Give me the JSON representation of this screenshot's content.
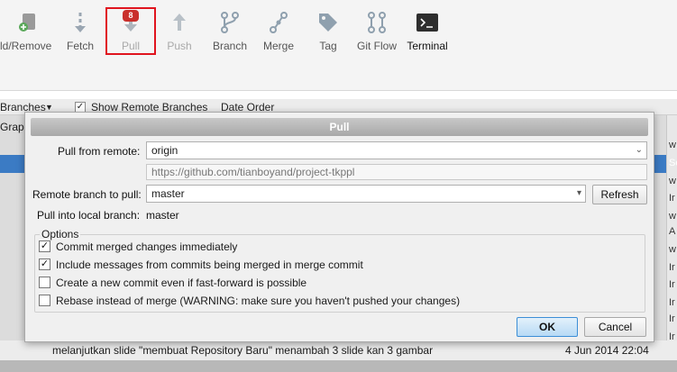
{
  "toolbar": {
    "add_remove_label": "ld/Remove",
    "fetch_label": "Fetch",
    "pull_label": "Pull",
    "pull_badge": "8",
    "push_label": "Push",
    "branch_label": "Branch",
    "merge_label": "Merge",
    "tag_label": "Tag",
    "gitflow_label": "Git Flow",
    "terminal_label": "Terminal"
  },
  "list_header": {
    "branches_label": "Branches",
    "show_remote_label": "Show Remote Branches",
    "show_remote_checked": true,
    "order_label": "Date Order",
    "graph_col": "Graph"
  },
  "background_list": {
    "right_letters": [
      "w",
      "Se",
      "w",
      "Ir",
      "w",
      "A",
      "w",
      "Ir",
      "Ir",
      "Ir",
      "Se",
      "Ir",
      "Ir",
      "w"
    ],
    "last_row_message": "melanjutkan slide \"membuat Repository Baru\" menambah 3 slide kan 3 gambar",
    "last_row_date": "4 Jun 2014 22:04"
  },
  "dialog": {
    "title": "Pull",
    "pull_from_remote_label": "Pull from remote:",
    "remote_value": "origin",
    "remote_url": "https://github.com/tianboyand/project-tkppl",
    "remote_branch_label": "Remote branch to pull:",
    "remote_branch_value": "master",
    "refresh_label": "Refresh",
    "local_branch_label": "Pull into local branch:",
    "local_branch_value": "master",
    "options_label": "Options",
    "options": [
      {
        "label": "Commit merged changes immediately",
        "checked": true
      },
      {
        "label": "Include messages from commits being merged in merge commit",
        "checked": true
      },
      {
        "label": "Create a new commit even if fast-forward is possible",
        "checked": false
      },
      {
        "label": "Rebase instead of merge (WARNING: make sure you haven't pushed your changes)",
        "checked": false
      }
    ],
    "ok_label": "OK",
    "cancel_label": "Cancel"
  },
  "colors": {
    "accent": "#3b7bc4",
    "highlight_border": "#e0141e",
    "badge": "#c9302c"
  }
}
